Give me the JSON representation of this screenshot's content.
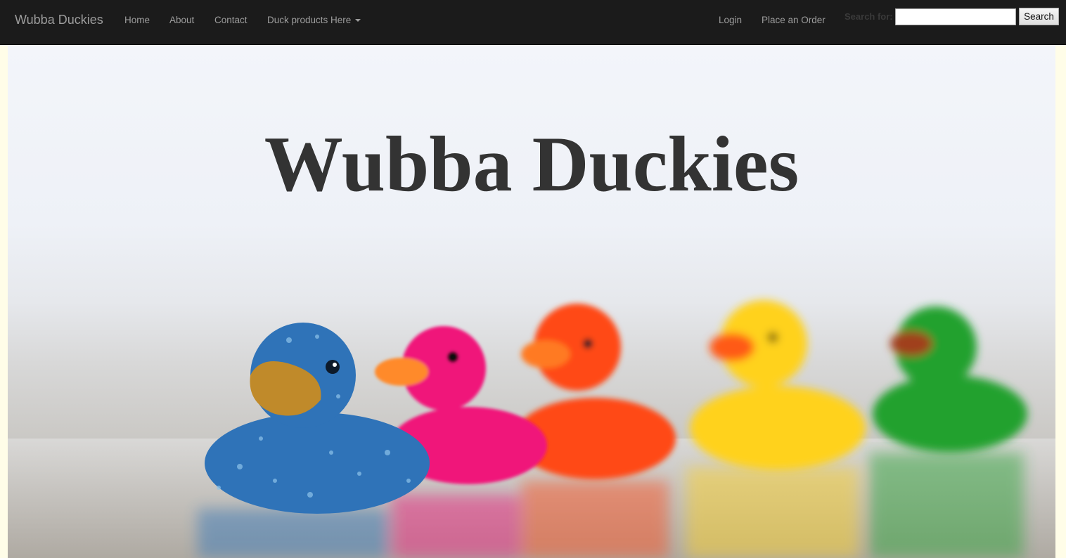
{
  "navbar": {
    "brand": "Wubba Duckies",
    "links": [
      "Home",
      "About",
      "Contact"
    ],
    "dropdown_label": "Duck products Here",
    "right_links": [
      "Login",
      "Place an Order"
    ],
    "search_label": "Search for:",
    "search_value": "",
    "search_button": "Search"
  },
  "hero": {
    "title": "Wubba Duckies",
    "duck_colors": [
      "#2f73b8",
      "#f0157a",
      "#ff4a12",
      "#ffd21a",
      "#23a12e"
    ]
  }
}
